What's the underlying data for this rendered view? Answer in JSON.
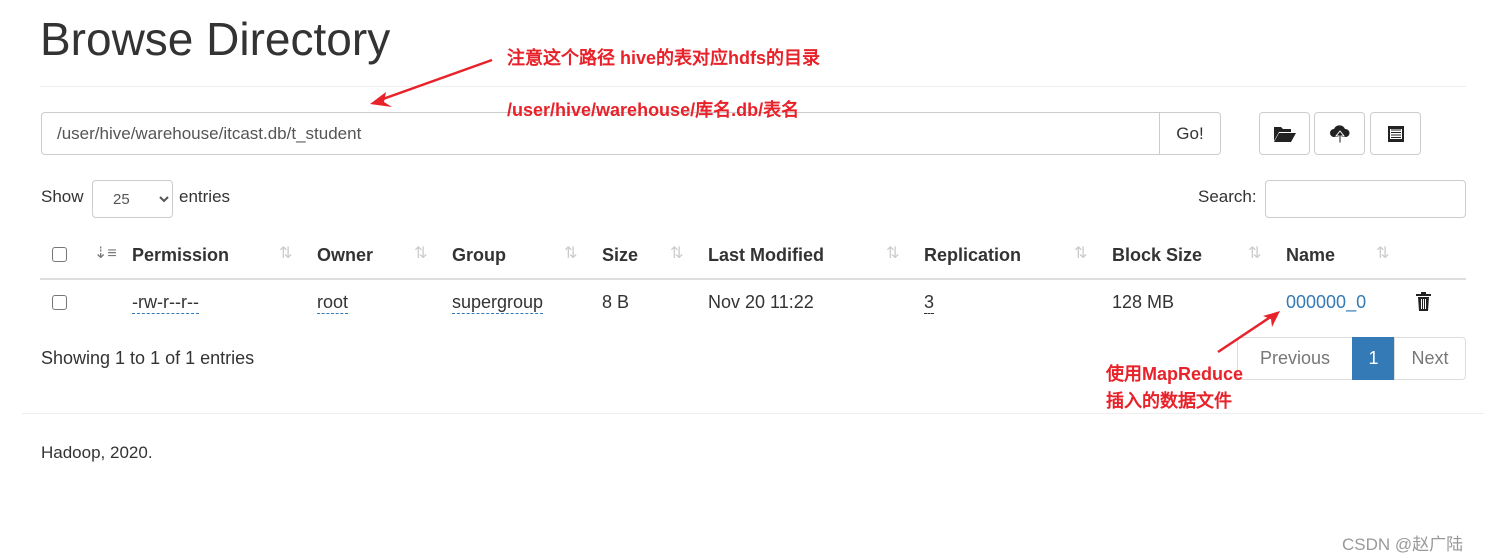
{
  "title": "Browse Directory",
  "path_input": {
    "value": "/user/hive/warehouse/itcast.db/t_student"
  },
  "go_label": "Go!",
  "toolbar_icons": [
    "folder-open-icon",
    "cloud-upload-icon",
    "list-icon"
  ],
  "show_label": "Show",
  "entries_select": "25",
  "entries_label": "entries",
  "search_label": "Search:",
  "columns": [
    "Permission",
    "Owner",
    "Group",
    "Size",
    "Last Modified",
    "Replication",
    "Block Size",
    "Name"
  ],
  "rows": [
    {
      "permission": "-rw-r--r--",
      "owner": "root",
      "group": "supergroup",
      "size": "8 B",
      "last_modified": "Nov 20 11:22",
      "replication": "3",
      "block_size": "128 MB",
      "name": "000000_0"
    }
  ],
  "showing": "Showing 1 to 1 of 1 entries",
  "pagination": {
    "previous": "Previous",
    "current": "1",
    "next": "Next"
  },
  "footer": "Hadoop, 2020.",
  "annotations": {
    "note1": "注意这个路径  hive的表对应hdfs的目录",
    "note2": "/user/hive/warehouse/库名.db/表名",
    "note3": "使用MapReduce",
    "note4": "插入的数据文件"
  },
  "watermark": "CSDN @赵广陆",
  "colors": {
    "link": "#337ab7",
    "annotation": "#e8222a",
    "active_page": "#337ab7"
  }
}
